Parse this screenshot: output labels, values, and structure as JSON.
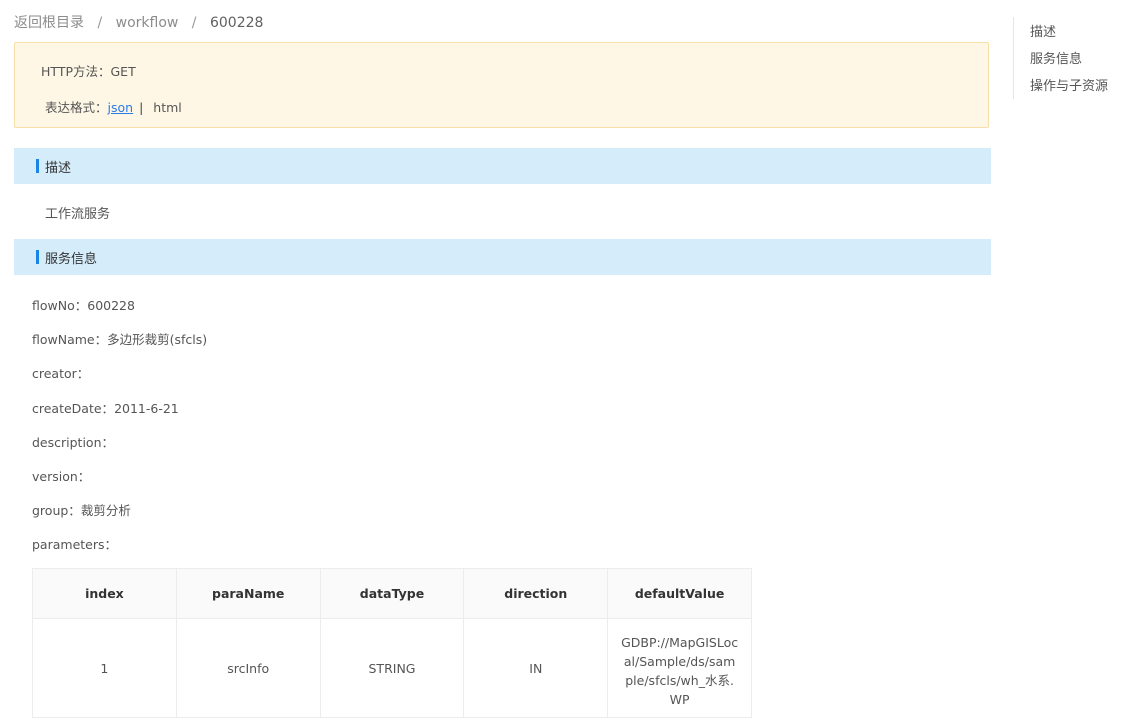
{
  "breadcrumb": {
    "root": "返回根目录",
    "sep": "/",
    "level1": "workflow",
    "current": "600228"
  },
  "info": {
    "http_method_label": "HTTP方法：",
    "http_method": "GET",
    "format_label": "表达格式：",
    "format_json": "json",
    "format_sep": "|",
    "format_html": "html"
  },
  "sections": {
    "description_title": "描述",
    "service_title": "服务信息"
  },
  "description_text": "工作流服务",
  "service_info": {
    "flowNo_label": "flowNo：",
    "flowNo": "600228",
    "flowName_label": "flowName：",
    "flowName": "多边形裁剪(sfcls)",
    "creator_label": "creator：",
    "createDate_label": "createDate：",
    "createDate": "2011-6-21",
    "description_label": "description：",
    "version_label": "version：",
    "group_label": "group：",
    "group": "裁剪分析",
    "parameters_label": "parameters："
  },
  "params_table": {
    "headers": [
      "index",
      "paraName",
      "dataType",
      "direction",
      "defaultValue"
    ],
    "rows": [
      [
        "1",
        "srcInfo",
        "STRING",
        "IN",
        "GDBP://MapGISLocal/Sample/ds/sample/sfcls/wh_水系.WP"
      ]
    ]
  },
  "toc": {
    "items": [
      "描述",
      "服务信息",
      "操作与子资源"
    ]
  },
  "colors": {
    "accent": "#1b84e7",
    "section_bg": "#d5ecfb",
    "info_bg": "#fef7e5",
    "link": "#2b7ce9"
  }
}
